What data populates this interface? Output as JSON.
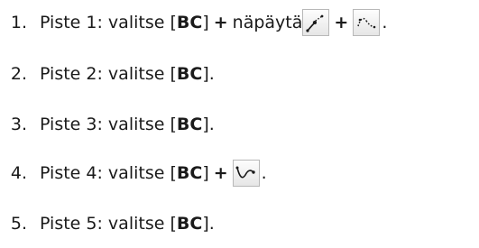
{
  "steps": [
    {
      "number": "1.",
      "text": "Piste 1: valitse [",
      "key": "BC",
      "close": "]",
      "plus1": "+",
      "middle": " näpäytä ",
      "plus2": "+",
      "end": ".",
      "icons": [
        "tangent-line-icon",
        "dotted-curve-icon"
      ]
    },
    {
      "number": "2.",
      "text": "Piste 2: valitse [",
      "key": "BC",
      "close": "]."
    },
    {
      "number": "3.",
      "text": "Piste 3: valitse [",
      "key": "BC",
      "close": "]."
    },
    {
      "number": "4.",
      "text": "Piste 4: valitse [",
      "key": "BC",
      "close": "]",
      "plus1": "+",
      "end": ".",
      "icons": [
        "wave-curve-icon"
      ]
    },
    {
      "number": "5.",
      "text": "Piste 5: valitse [",
      "key": "BC",
      "close": "]."
    }
  ]
}
